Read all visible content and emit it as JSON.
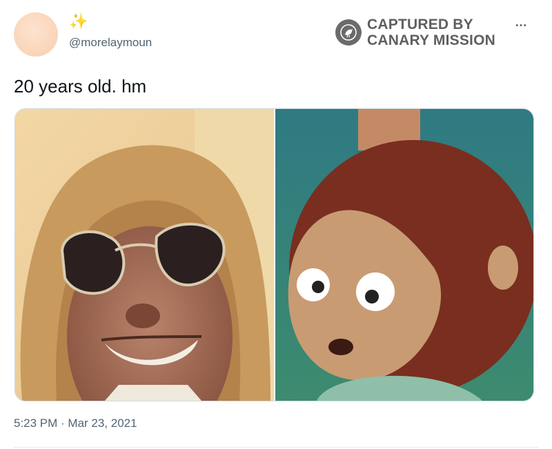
{
  "tweet": {
    "display_name": "✨",
    "handle": "@morelaymoun",
    "text": "20 years old. hm",
    "timestamp": "5:23 PM · Mar 23, 2021",
    "more_icon": "…"
  },
  "watermark": {
    "line1": "CAPTURED BY",
    "line2": "CANARY MISSION",
    "logo_icon": "canary-bird-icon"
  },
  "media": [
    {
      "name": "man-with-heart-sunglasses-image"
    },
    {
      "name": "puppet-monkey-image"
    }
  ]
}
